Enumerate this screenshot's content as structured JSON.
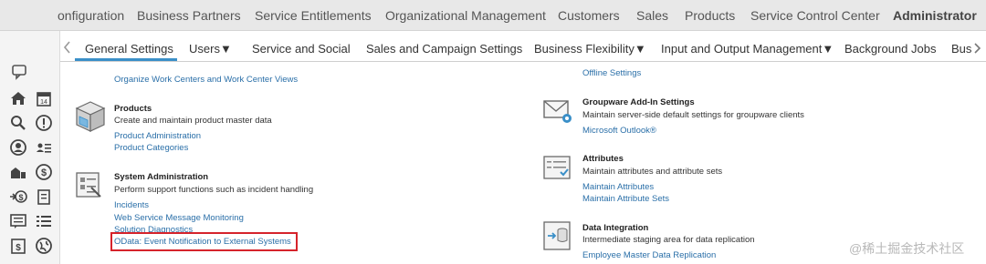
{
  "top_nav": {
    "items": [
      {
        "label": "onfiguration"
      },
      {
        "label": "Business Partners"
      },
      {
        "label": "Service Entitlements"
      },
      {
        "label": "Organizational Management"
      },
      {
        "label": "Customers"
      },
      {
        "label": "Sales"
      },
      {
        "label": "Products"
      },
      {
        "label": "Service Control Center"
      },
      {
        "label": "Administrator"
      }
    ],
    "active": "Administrator"
  },
  "sub_nav": {
    "tabs": [
      {
        "label": "General Settings"
      },
      {
        "label": "Users▼"
      },
      {
        "label": "Service and Social"
      },
      {
        "label": "Sales and Campaign Settings"
      },
      {
        "label": "Business Flexibility▼"
      },
      {
        "label": "Input and Output Management▼"
      },
      {
        "label": "Background Jobs"
      },
      {
        "label": "Bus"
      }
    ],
    "active": "General Settings"
  },
  "left_column": {
    "top_link": "Organize Work Centers and Work Center Views",
    "products": {
      "title": "Products",
      "description": "Create and maintain product master data",
      "links": [
        "Product Administration",
        "Product Categories"
      ]
    },
    "system_administration": {
      "title": "System Administration",
      "description": "Perform support functions such as incident handling",
      "links": [
        "Incidents",
        "Web Service Message Monitoring",
        "Solution Diagnostics",
        "OData: Event Notification to External Systems"
      ],
      "highlighted_link": "OData: Event Notification to External Systems"
    }
  },
  "right_column": {
    "top_link": "Offline Settings",
    "groupware": {
      "title": "Groupware Add-In Settings",
      "description": "Maintain server-side default settings for groupware clients",
      "links": [
        "Microsoft Outlook®"
      ]
    },
    "attributes": {
      "title": "Attributes",
      "description": "Maintain attributes and attribute sets",
      "links": [
        "Maintain Attributes",
        "Maintain Attribute Sets"
      ]
    },
    "data_integration": {
      "title": "Data Integration",
      "description": "Intermediate staging area for data replication",
      "links": [
        "Employee Master Data Replication"
      ]
    }
  },
  "watermark": "@稀土掘金技术社区",
  "colors": {
    "top_bar_bg": "#e8e8e8",
    "link": "#2a6fa8",
    "active_underline": "#3a8fc8",
    "highlight_box": "#d6232b"
  }
}
